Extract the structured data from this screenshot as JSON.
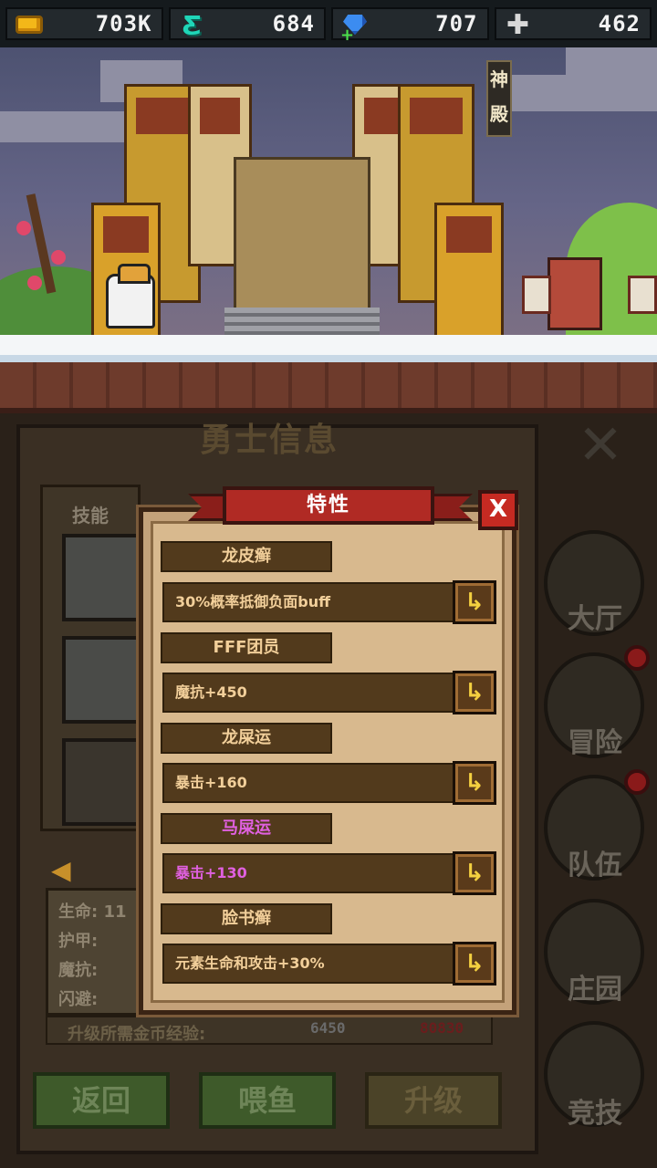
{
  "resources": {
    "gold": {
      "icon": "gold-coin-icon",
      "value": "703K"
    },
    "fish": {
      "icon": "fish-currency-icon",
      "value": "684"
    },
    "gems": {
      "icon": "gem-icon",
      "value": "707"
    },
    "cross": {
      "icon": "cross-icon",
      "value": "462"
    }
  },
  "scene": {
    "sign_text": "神殿"
  },
  "hero_info": {
    "title": "勇士信息",
    "skill_label": "技能",
    "stats": [
      "生命:",
      "护甲:",
      "魔抗:",
      "闪避:"
    ],
    "hp_partial": "11",
    "exp_label": "升级所需金币经验:",
    "exp_value": "6450",
    "exp_cost": "80830",
    "buttons": {
      "back": "返回",
      "feed": "喂鱼",
      "upgrade": "升级"
    }
  },
  "nav": {
    "hall": "大厅",
    "adventure": "冒险",
    "team": "队伍",
    "manor": "庄园",
    "arena": "竞技"
  },
  "traits_modal": {
    "title": "特性",
    "close": "X",
    "traits": [
      {
        "name": "龙皮癣",
        "desc": "30%概率抵御负面buff",
        "rarity": "normal"
      },
      {
        "name": "FFF团员",
        "desc": "魔抗+450",
        "rarity": "normal"
      },
      {
        "name": "龙屎运",
        "desc": "暴击+160",
        "rarity": "normal"
      },
      {
        "name": "马屎运",
        "desc": "暴击+130",
        "rarity": "epic"
      },
      {
        "name": "脸书癣",
        "desc": "元素生命和攻击+30%",
        "rarity": "normal"
      }
    ]
  },
  "colors": {
    "trait_normal": "#f2cf9a",
    "trait_epic": "#e060e0",
    "banner_red": "#b02a24"
  }
}
